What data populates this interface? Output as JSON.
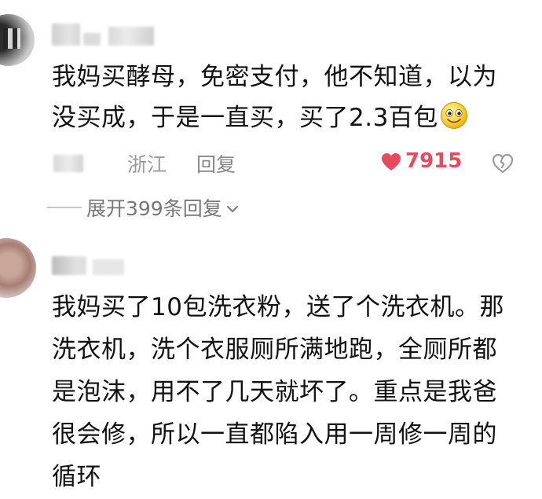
{
  "comments": [
    {
      "text_line1": "我妈买酵母，免密支付，他不知道，以为",
      "text_line2": "没买成，于是一直买，买了2.3百包",
      "location": "浙江",
      "reply_label": "回复",
      "like_count": "7915",
      "liked": true,
      "expand_label": "展开399条回复",
      "heart_color": "#e64a5e"
    },
    {
      "text_lines": [
        "我妈买了10包洗衣粉，送了个洗衣机。那",
        "洗衣机，洗个衣服厕所满地跑，全厕所都",
        "是泡沫，用不了几天就坏了。重点是我爸",
        "很会修，所以一直都陷入用一周修一周的",
        "循环"
      ]
    }
  ],
  "icons": {
    "emoji": "smiley-emoji-icon",
    "like": "heart-icon",
    "dislike": "broken-heart-icon",
    "expand": "chevron-down-icon"
  }
}
